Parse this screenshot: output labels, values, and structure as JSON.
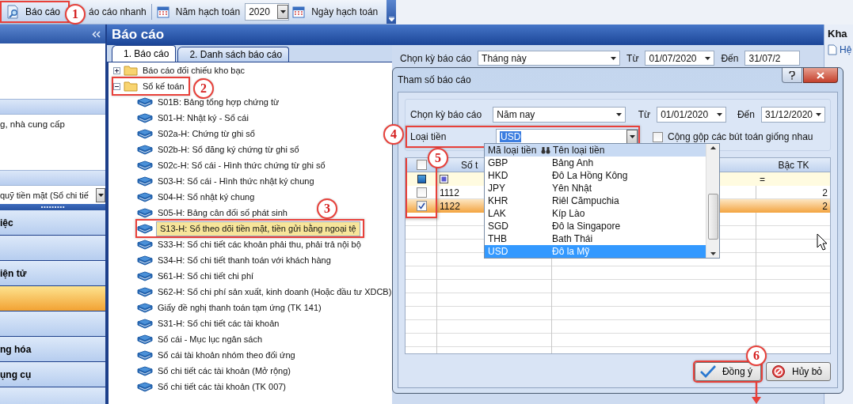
{
  "toolbar": {
    "report_button": {
      "label": "Báo cáo",
      "highlighted": true
    },
    "quick_report": "áo cáo nhanh",
    "year_label": "Năm hạch toán",
    "year_value": "2020",
    "date_label": "Ngày hạch toán"
  },
  "left_panel": {
    "group_text": "g, nhà cung cấp",
    "combo_value": "quỹ tiền mặt (Sổ chi tiế",
    "nav_items": [
      {
        "label": "iệc",
        "selected": false
      },
      {
        "selected": false
      },
      {
        "label": "iện tử",
        "selected": false
      },
      {
        "selected": true
      },
      {
        "selected": false
      },
      {
        "label": "ng hóa",
        "selected": false
      },
      {
        "label": "ụng cụ",
        "selected": false
      },
      {
        "selected": false
      }
    ]
  },
  "main": {
    "title": "Báo cáo",
    "tabs": [
      {
        "label": "1. Báo cáo",
        "selected": true
      },
      {
        "label": "2. Danh sách báo cáo",
        "selected": false
      }
    ],
    "tree": [
      {
        "label": "Báo cáo đối chiếu kho bạc",
        "expanded": false,
        "highlighted": false
      },
      {
        "label": "Sổ kế toán",
        "expanded": true,
        "highlighted": true,
        "children": [
          {
            "label": "S01B: Bảng tổng hợp chứng từ",
            "selected": false,
            "highlighted": false
          },
          {
            "label": "S01-H: Nhật ký - Sổ cái",
            "selected": false,
            "highlighted": false
          },
          {
            "label": "S02a-H: Chứng từ ghi sổ",
            "selected": false,
            "highlighted": false
          },
          {
            "label": "S02b-H: Sổ đăng ký chứng từ ghi sổ",
            "selected": false,
            "highlighted": false
          },
          {
            "label": "S02c-H: Sổ cái - Hình thức chứng từ ghi sổ",
            "selected": false,
            "highlighted": false
          },
          {
            "label": "S03-H: Sổ cái - Hình thức nhật ký chung",
            "selected": false,
            "highlighted": false
          },
          {
            "label": "S04-H: Sổ nhật ký chung",
            "selected": false,
            "highlighted": false
          },
          {
            "label": "S05-H: Bảng cân đối số phát sinh",
            "selected": false,
            "highlighted": false
          },
          {
            "label": "S13-H: Sổ theo dõi tiền mặt, tiền gửi bằng ngoại tệ",
            "selected": true,
            "highlighted": true
          },
          {
            "label": "S33-H: Sổ chi tiết các khoản phải thu, phải trả nội bộ",
            "selected": false,
            "highlighted": false
          },
          {
            "label": "S34-H: Sổ chi tiết thanh toán với khách hàng",
            "selected": false,
            "highlighted": false
          },
          {
            "label": "S61-H: Sổ chi tiết chi phí",
            "selected": false,
            "highlighted": false
          },
          {
            "label": "S62-H: Sổ chi phí sản xuất, kinh doanh (Hoặc đầu tư XDCB)",
            "selected": false,
            "highlighted": false
          },
          {
            "label": "Giấy đề nghị thanh toán tạm ứng (TK 141)",
            "selected": false,
            "highlighted": false
          },
          {
            "label": "S31-H: Sổ chi tiết các tài khoản",
            "selected": false,
            "highlighted": false
          },
          {
            "label": "Sổ cái - Mục lục ngân sách",
            "selected": false,
            "highlighted": false
          },
          {
            "label": "Sổ cái tài khoản nhóm theo đối ứng",
            "selected": false,
            "highlighted": false
          },
          {
            "label": "Sổ chi tiết các tài khoản (Mở rộng)",
            "selected": false,
            "highlighted": false
          },
          {
            "label": "Sổ chi tiết các tài khoản (TK 007)",
            "selected": false,
            "highlighted": false
          }
        ]
      }
    ],
    "period": {
      "label": "Chọn kỳ báo cáo",
      "value": "Tháng này",
      "from_label": "Từ",
      "from": "01/07/2020",
      "to_label": "Đến",
      "to": "31/07/2"
    }
  },
  "right_panel": {
    "title": "Kha",
    "item": "Hệ"
  },
  "dialog": {
    "title": "Tham số báo cáo",
    "period": {
      "label": "Chọn kỳ báo cáo",
      "value": "Năm nay",
      "from_label": "Từ",
      "from": "01/01/2020",
      "to_label": "Đến",
      "to": "31/12/2020"
    },
    "currency": {
      "label": "Loại tiền",
      "value": "USD",
      "highlighted": true
    },
    "merge_checkbox": {
      "label": "Cộng gộp các bút toán giống nhau",
      "checked": false
    },
    "grid": {
      "header_checked": false,
      "account_header": "Số t",
      "level_header": "Bậc TK",
      "filter_operator": "=",
      "check_column_highlighted": true,
      "rows": [
        {
          "account": "1112",
          "level": "2",
          "checked": false,
          "selected": false
        },
        {
          "account": "1122",
          "level": "2",
          "checked": true,
          "selected": true
        }
      ]
    },
    "currency_dropdown": {
      "code_header": "Mã loại tiền",
      "name_header": "Tên loại tiền",
      "options": [
        {
          "code": "GBP",
          "name": "Bảng Anh",
          "selected": false
        },
        {
          "code": "HKD",
          "name": "Đô La Hồng Kông",
          "selected": false
        },
        {
          "code": "JPY",
          "name": "Yên Nhật",
          "selected": false
        },
        {
          "code": "KHR",
          "name": "Riêl Cămpuchia",
          "selected": false
        },
        {
          "code": "LAK",
          "name": "Kíp Lào",
          "selected": false
        },
        {
          "code": "SGD",
          "name": "Đô la Singapore",
          "selected": false
        },
        {
          "code": "THB",
          "name": "Bath Thái",
          "selected": false
        },
        {
          "code": "USD",
          "name": "Đô la Mỹ",
          "selected": true
        }
      ]
    },
    "buttons": [
      {
        "kind": "ok",
        "label": "Đồng ý",
        "highlighted": true
      },
      {
        "kind": "cancel",
        "label": "Hủy bỏ",
        "highlighted": false
      }
    ]
  },
  "annotations": [
    {
      "number": "1",
      "arrow": false
    },
    {
      "number": "2",
      "arrow": false
    },
    {
      "number": "3",
      "arrow": false
    },
    {
      "number": "4",
      "arrow": false
    },
    {
      "number": "5",
      "arrow": false
    },
    {
      "number": "6",
      "arrow": true
    }
  ]
}
